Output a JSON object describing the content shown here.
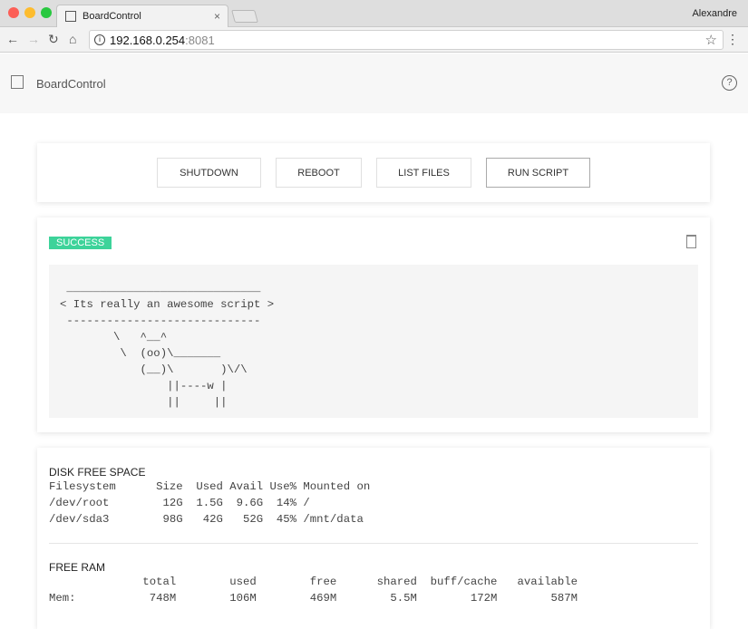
{
  "browser": {
    "tab_title": "BoardControl",
    "user": "Alexandre",
    "url_host": "192.168.0.254",
    "url_port": ":8081"
  },
  "app": {
    "title": "BoardControl",
    "help": "?"
  },
  "actions": {
    "shutdown": "SHUTDOWN",
    "reboot": "REBOOT",
    "list_files": "LIST FILES",
    "run_script": "RUN SCRIPT"
  },
  "result": {
    "status": "SUCCESS",
    "status_color": "#3dd39a",
    "output": " _____________________________\n< Its really an awesome script >\n -----------------------------\n        \\   ^__^\n         \\  (oo)\\_______\n            (__)\\       )\\/\\\n                ||----w |\n                ||     ||"
  },
  "disk": {
    "heading": "DISK FREE SPACE",
    "output": "Filesystem      Size  Used Avail Use% Mounted on\n/dev/root        12G  1.5G  9.6G  14% /\n/dev/sda3        98G   42G   52G  45% /mnt/data"
  },
  "ram": {
    "heading": "FREE RAM",
    "output": "              total        used        free      shared  buff/cache   available\nMem:           748M        106M        469M        5.5M        172M        587M"
  }
}
